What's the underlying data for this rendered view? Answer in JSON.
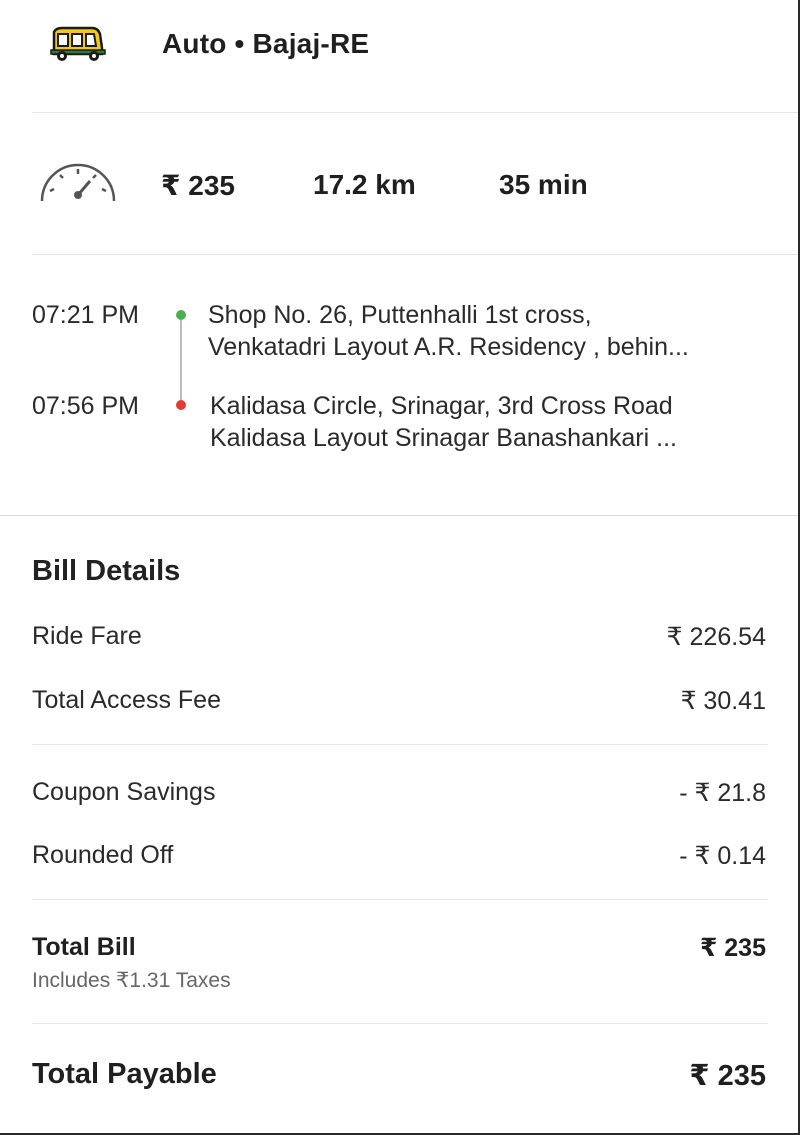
{
  "header": {
    "title": "Auto • Bajaj-RE",
    "vehicle_icon": "auto-rickshaw-icon",
    "vehicle_color": "#f5c518"
  },
  "stats": {
    "speed_icon": "speedometer-icon",
    "fare": "₹ 235",
    "distance": "17.2 km",
    "duration": "35 min"
  },
  "route": {
    "pickup": {
      "time": "07:21 PM",
      "line1": "Shop No. 26, Puttenhalli 1st cross,",
      "line2": "Venkatadri Layout A.R. Residency , behin...",
      "dot_color": "#4caf50"
    },
    "drop": {
      "time": "07:56 PM",
      "line1": "Kalidasa Circle, Srinagar, 3rd Cross Road",
      "line2": "Kalidasa Layout Srinagar Banashankari ...",
      "dot_color": "#e53935"
    }
  },
  "bill": {
    "title": "Bill Details",
    "ride_fare": {
      "label": "Ride Fare",
      "value": "₹ 226.54"
    },
    "access_fee": {
      "label": "Total Access Fee",
      "value": "₹ 30.41"
    },
    "coupon": {
      "label": "Coupon Savings",
      "value": "- ₹ 21.8"
    },
    "rounded": {
      "label": "Rounded Off",
      "value": "- ₹ 0.14"
    },
    "total_bill": {
      "label": "Total Bill",
      "value": "₹ 235",
      "note": "Includes ₹1.31 Taxes"
    },
    "total_payable": {
      "label": "Total Payable",
      "value": "₹ 235"
    }
  }
}
